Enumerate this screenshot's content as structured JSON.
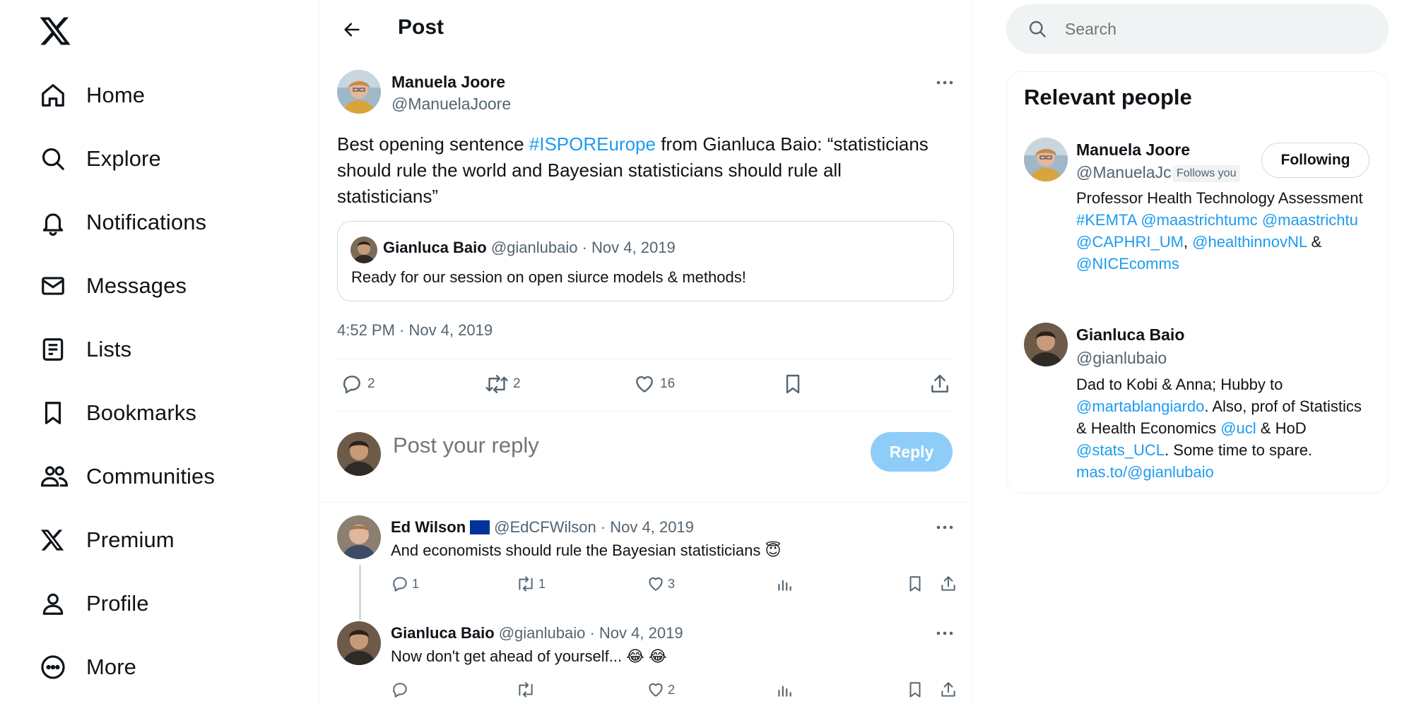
{
  "nav": {
    "items": [
      {
        "label": "Home",
        "icon": "home-icon"
      },
      {
        "label": "Explore",
        "icon": "search-icon"
      },
      {
        "label": "Notifications",
        "icon": "bell-icon"
      },
      {
        "label": "Messages",
        "icon": "envelope-icon"
      },
      {
        "label": "Lists",
        "icon": "list-icon"
      },
      {
        "label": "Bookmarks",
        "icon": "bookmark-icon"
      },
      {
        "label": "Communities",
        "icon": "communities-icon"
      },
      {
        "label": "Premium",
        "icon": "x-logo-icon"
      },
      {
        "label": "Profile",
        "icon": "person-icon"
      },
      {
        "label": "More",
        "icon": "more-circle-icon"
      }
    ]
  },
  "header": {
    "title": "Post"
  },
  "post": {
    "author_name": "Manuela Joore",
    "author_handle": "@ManuelaJoore",
    "text_before": "Best opening sentence ",
    "hashtag": "#ISPOREurope",
    "text_after": "  from Gianluca Baio: “statisticians should rule the world and Bayesian statisticians should rule all statisticians”",
    "quote": {
      "name": "Gianluca Baio",
      "meta": "@gianlubaio · Nov 4, 2019",
      "text": "Ready for our session on open siurce models & methods!"
    },
    "timestamp": "4:52 PM · Nov 4, 2019",
    "stats": {
      "replies": "2",
      "reposts": "2",
      "likes": "16"
    }
  },
  "compose": {
    "placeholder": "Post your reply",
    "button": "Reply"
  },
  "replies": [
    {
      "name": "Ed Wilson",
      "meta": "@EdCFWilson · Nov 4, 2019",
      "text": "And economists should rule the Bayesian statisticians 😇",
      "replies": "1",
      "reposts": "1",
      "likes": "3"
    },
    {
      "name": "Gianluca Baio",
      "meta": "@gianlubaio · Nov 4, 2019",
      "text": "Now don't get ahead of yourself... 😂 😂",
      "replies": "",
      "reposts": "",
      "likes": "2"
    }
  ],
  "search": {
    "placeholder": "Search"
  },
  "relevant": {
    "title": "Relevant people",
    "people": [
      {
        "name": "Manuela Joore",
        "handle": "@ManuelaJc",
        "follows_you": "Follows you",
        "button": "Following",
        "bio": [
          {
            "t": "Professor Health Technology Assessment ",
            "link": false
          },
          {
            "t": "#KEMTA",
            "link": true
          },
          {
            "t": " ",
            "link": false
          },
          {
            "t": "@maastrichtumc",
            "link": true
          },
          {
            "t": " ",
            "link": false
          },
          {
            "t": "@maastrichtu",
            "link": true
          },
          {
            "t": " ",
            "link": false
          },
          {
            "t": "@CAPHRI_UM",
            "link": true
          },
          {
            "t": ", ",
            "link": false
          },
          {
            "t": "@healthinnovNL",
            "link": true
          },
          {
            "t": " & ",
            "link": false
          },
          {
            "t": "@NICEcomms",
            "link": true
          }
        ]
      },
      {
        "name": "Gianluca Baio",
        "handle": "@gianlubaio",
        "bio": [
          {
            "t": "Dad to Kobi & Anna; Hubby to ",
            "link": false
          },
          {
            "t": "@martablangiardo",
            "link": true
          },
          {
            "t": ". Also, prof of Statistics & Health Economics ",
            "link": false
          },
          {
            "t": "@ucl",
            "link": true
          },
          {
            "t": " & HoD ",
            "link": false
          },
          {
            "t": "@stats_UCL",
            "link": true
          },
          {
            "t": ". Some time to spare. ",
            "link": false
          },
          {
            "t": "mas.to/@gianlubaio",
            "link": true
          }
        ]
      }
    ]
  },
  "colors": {
    "accent": "#1d9bf0",
    "muted": "#536471",
    "text": "#0f1419",
    "reply_button": "#8ecdf7"
  }
}
